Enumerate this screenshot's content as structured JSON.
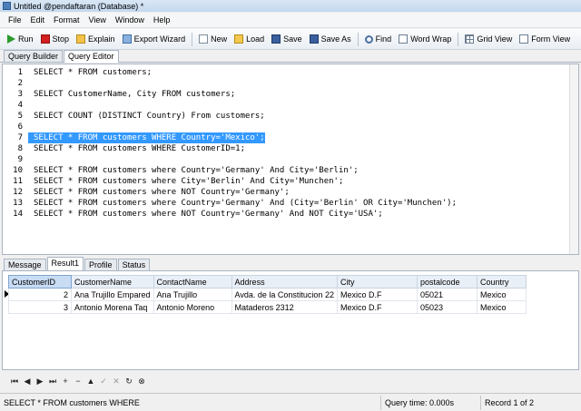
{
  "window": {
    "title": "Untitled @pendaftaran (Database) *"
  },
  "menu": [
    {
      "label": "File",
      "accel": "F"
    },
    {
      "label": "Edit",
      "accel": "E"
    },
    {
      "label": "Format",
      "accel": "o"
    },
    {
      "label": "View",
      "accel": "V"
    },
    {
      "label": "Window",
      "accel": "W"
    },
    {
      "label": "Help",
      "accel": "H"
    }
  ],
  "toolbar": {
    "run": "Run",
    "stop": "Stop",
    "explain": "Explain",
    "export_wizard": "Export Wizard",
    "new": "New",
    "load": "Load",
    "save": "Save",
    "save_as": "Save As",
    "find": "Find",
    "word_wrap": "Word Wrap",
    "grid_view": "Grid View",
    "form_view": "Form View"
  },
  "editor_tabs": {
    "query_builder": "Query Builder",
    "query_editor": "Query Editor"
  },
  "editor": {
    "lines": [
      "SELECT * FROM customers;",
      "",
      "SELECT CustomerName, City FROM customers;",
      "",
      "SELECT COUNT (DISTINCT Country) From customers;",
      "",
      "SELECT * FROM customers WHERE Country='Mexico';",
      "SELECT * FROM customers WHERE CustomerID=1;",
      "",
      "SELECT * FROM customers where Country='Germany' And City='Berlin';",
      "SELECT * FROM customers where City='Berlin' And City='Munchen';",
      "SELECT * FROM customers where NOT Country='Germany';",
      "SELECT * FROM customers where Country='Germany' And (City='Berlin' OR City='Munchen');",
      "SELECT * FROM customers where NOT Country='Germany' And NOT City='USA';"
    ],
    "line_numbers": [
      "1",
      "2",
      "3",
      "4",
      "5",
      "6",
      "7",
      "8",
      "9",
      "10",
      "11",
      "12",
      "13",
      "14"
    ]
  },
  "result_tabs": {
    "message": "Message",
    "result1": "Result1",
    "profile": "Profile",
    "status": "Status"
  },
  "grid": {
    "columns": [
      "CustomerID",
      "CustomerName",
      "ContactName",
      "Address",
      "City",
      "postalcode",
      "Country"
    ],
    "rows": [
      [
        "2",
        "Ana Trujillo Empared",
        "Ana Trujillo",
        "Avda. de la Constitucion 22",
        "Mexico D.F",
        "05021",
        "Mexico"
      ],
      [
        "3",
        "Antonio Morena Taq",
        "Antonio Moreno",
        "Mataderos 2312",
        "Mexico D.F",
        "05023",
        "Mexico"
      ]
    ]
  },
  "navbar": {
    "first": "⏮",
    "prev": "◀",
    "next": "▶",
    "last": "⏭",
    "add": "+",
    "delete": "−",
    "up": "▲",
    "check": "✓",
    "cancel": "✕",
    "refresh": "↻",
    "stop": "⊗"
  },
  "status": {
    "query_text": "SELECT * FROM customers WHERE",
    "query_time": "Query time: 0.000s",
    "record": "Record 1 of 2"
  }
}
